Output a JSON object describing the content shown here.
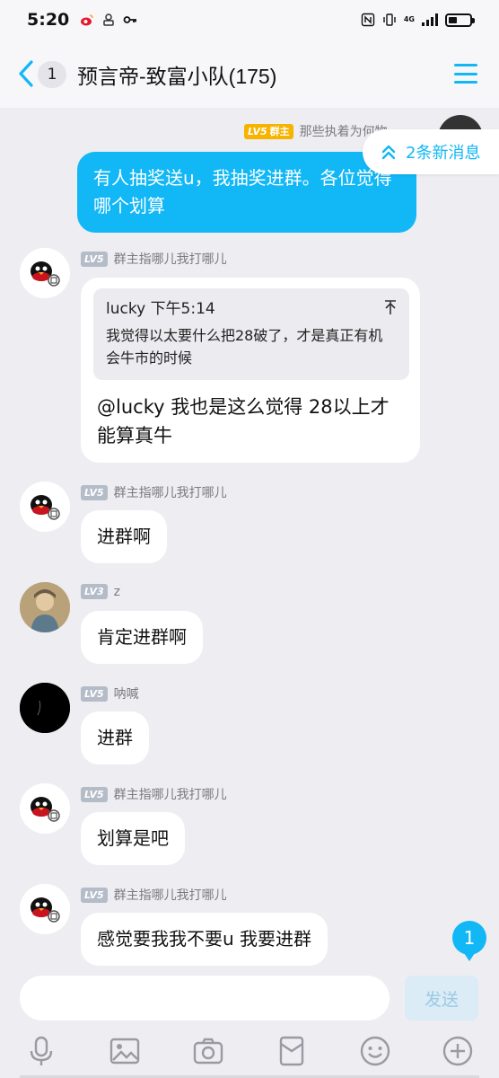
{
  "status_bar": {
    "time": "5:20",
    "network": "4G"
  },
  "header": {
    "unread_count": "1",
    "title": "预言帝-致富小队(175)"
  },
  "new_messages_label": "2条新消息",
  "messages": [
    {
      "level": "LV5",
      "role": "群主",
      "sender": "那些执着为何物",
      "text": "有人抽奖送u，我抽奖进群。各位觉得哪个划算",
      "self": true
    },
    {
      "level": "LV5",
      "sender": "群主指哪儿我打哪儿",
      "quote_author": "lucky",
      "quote_time": "下午5:14",
      "quote_text": "我觉得以太要什么把28破了，才是真正有机会牛市的时候",
      "text": "@lucky 我也是这么觉得 28以上才能算真牛"
    },
    {
      "level": "LV5",
      "sender": "群主指哪儿我打哪儿",
      "text": "进群啊"
    },
    {
      "level": "LV3",
      "sender": "z",
      "text": "肯定进群啊"
    },
    {
      "level": "LV5",
      "sender": "呐喊",
      "text": "进群"
    },
    {
      "level": "LV5",
      "sender": "群主指哪儿我打哪儿",
      "text": "划算是吧"
    },
    {
      "level": "LV5",
      "sender": "群主指哪儿我打哪儿",
      "text": "感觉要我我不要u 我要进群"
    }
  ],
  "unread_badge": "1",
  "input": {
    "placeholder": "",
    "send_label": "发送"
  },
  "toolbar": [
    "mic-icon",
    "image-icon",
    "camera-icon",
    "red-packet-icon",
    "emoji-icon",
    "plus-icon"
  ],
  "colors": {
    "accent": "#12b7f5",
    "background": "#ededf2",
    "owner_badge": "#f6b400",
    "level_badge": "#b4bcc8"
  }
}
